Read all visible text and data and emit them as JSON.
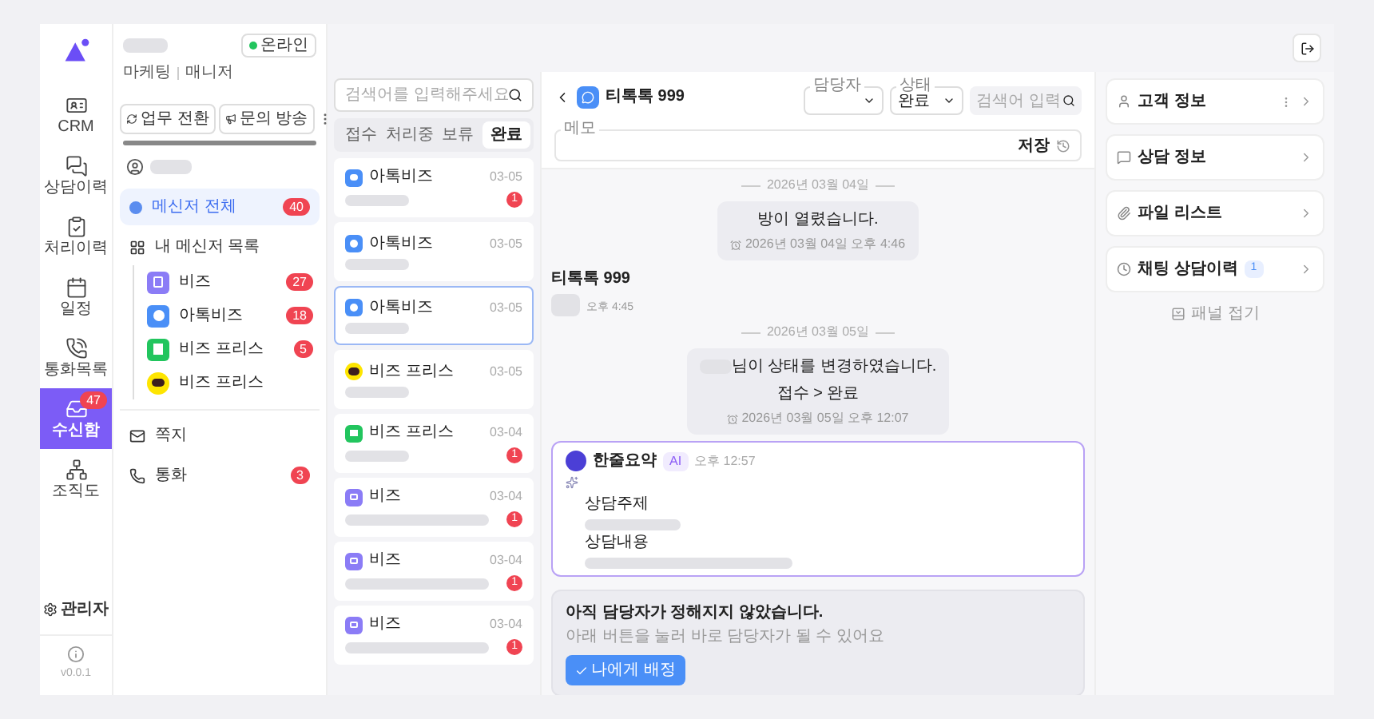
{
  "rail": {
    "items": [
      {
        "kind": "crm",
        "label": "CRM",
        "selected": false
      },
      {
        "kind": "history",
        "label": "상담이력",
        "selected": false
      },
      {
        "kind": "process",
        "label": "처리이력",
        "selected": false
      },
      {
        "kind": "calendar",
        "label": "일정",
        "selected": false
      },
      {
        "kind": "calls",
        "label": "통화목록",
        "selected": false
      },
      {
        "kind": "inbox",
        "label": "수신함",
        "selected": true,
        "badge": "47"
      },
      {
        "kind": "org",
        "label": "조직도",
        "selected": false
      }
    ],
    "admin": "관리자",
    "version": "v0.0.1"
  },
  "profile": {
    "team": "마케팅",
    "role": "매니저",
    "status": "온라인"
  },
  "panel": {
    "actions": [
      "업무 전환",
      "문의 방송"
    ],
    "items": [
      {
        "kind": "all",
        "label": "메신저 전체",
        "count": "40",
        "selected": true
      },
      {
        "kind": "group",
        "label": "내 메신저 목록",
        "selected": false,
        "children": [
          {
            "kind": "biz",
            "label": "비즈",
            "count": "27",
            "color": "#8b7cf6",
            "selected": false
          },
          {
            "kind": "talk",
            "label": "아톡비즈",
            "count": "18",
            "color": "#4a8ff7",
            "selected": false
          },
          {
            "kind": "naver",
            "label": "비즈 프리스",
            "count": "5",
            "color": "#22c55e",
            "selected": false
          },
          {
            "kind": "kakao",
            "label": "비즈 프리스",
            "color": "#fee500",
            "selected": false
          }
        ]
      },
      {
        "kind": "note",
        "label": "쪽지",
        "selected": false
      },
      {
        "kind": "call",
        "label": "통화",
        "count": "3",
        "selected": false
      }
    ]
  },
  "list": {
    "search": {
      "placeholder": "검색어를 입력해주세요"
    },
    "tabs": [
      {
        "label": "접수",
        "selected": false
      },
      {
        "label": "처리중",
        "selected": false
      },
      {
        "label": "보류",
        "selected": false
      },
      {
        "label": "완료",
        "selected": true
      }
    ],
    "items": [
      {
        "kind": "talk",
        "name": "아톡비즈",
        "date": "03-05",
        "unread": "1",
        "selected": false
      },
      {
        "kind": "talk",
        "name": "아톡비즈",
        "date": "03-05",
        "selected": false
      },
      {
        "kind": "talk",
        "name": "아톡비즈",
        "date": "03-05",
        "selected": true
      },
      {
        "kind": "kakao",
        "name": "비즈 프리스",
        "date": "03-05",
        "selected": false
      },
      {
        "kind": "naver",
        "name": "비즈 프리스",
        "date": "03-04",
        "unread": "1",
        "selected": false
      },
      {
        "kind": "biz",
        "name": "비즈",
        "date": "03-04",
        "unread": "1",
        "selected": false
      },
      {
        "kind": "biz",
        "name": "비즈",
        "date": "03-04",
        "unread": "1",
        "selected": false
      },
      {
        "kind": "biz",
        "name": "비즈",
        "date": "03-04",
        "unread": "1",
        "selected": false
      }
    ]
  },
  "chat": {
    "title": "티톡톡 999",
    "assignee": {
      "label": "담당자"
    },
    "status": {
      "label": "상태",
      "value": "완료"
    },
    "search": {
      "placeholder": "검색어 입력"
    },
    "memo": {
      "label": "메모",
      "save": "저장"
    },
    "messages": [
      {
        "kind": "divider",
        "text": "2026년 03월 04일"
      },
      {
        "kind": "system",
        "text": "방이 열렸습니다.",
        "time": "2026년 03월 04일 오후 4:46"
      },
      {
        "kind": "customer",
        "name": "티톡톡 999",
        "time": "오후 4:45"
      },
      {
        "kind": "divider",
        "text": "2026년 03월 05일"
      },
      {
        "kind": "system",
        "redacted_name": true,
        "text": "님이 상태를 변경하였습니다.",
        "detail": "접수 > 완료",
        "time": "2026년 03월 05일 오후 12:07"
      },
      {
        "kind": "ai",
        "title": "한줄요약",
        "badge": "AI",
        "time": "오후 12:57",
        "sections": [
          "상담주제",
          "상담내용"
        ]
      }
    ],
    "assign": {
      "title": "아직 담당자가 정해지지 않았습니다.",
      "hint": "아래 버튼을 눌러 바로 담당자가 될 수 있어요",
      "button": "나에게 배정"
    }
  },
  "details": {
    "sections": [
      {
        "kind": "customer",
        "title": "고객 정보",
        "menu": true
      },
      {
        "kind": "consult",
        "title": "상담 정보",
        "menu": false
      },
      {
        "kind": "files",
        "title": "파일 리스트",
        "menu": false
      },
      {
        "kind": "history",
        "title": "채팅 상담이력",
        "badge": "1",
        "menu": false
      }
    ],
    "footer": "패널 접기"
  }
}
